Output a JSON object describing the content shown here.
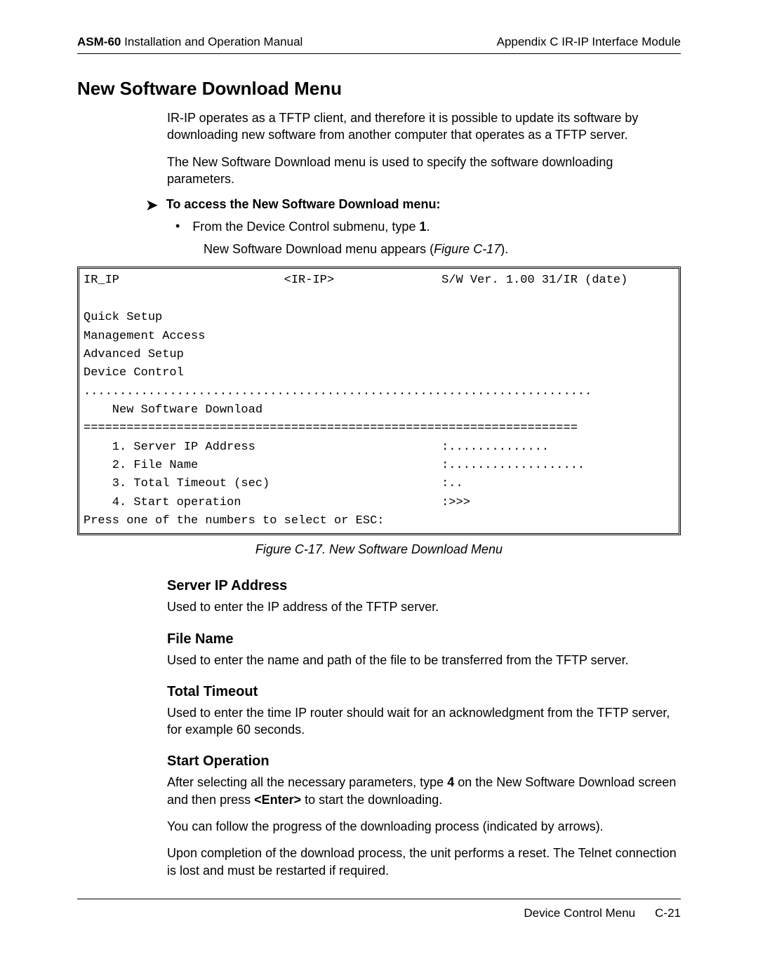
{
  "header": {
    "product": "ASM-60",
    "doc_title": "Installation and Operation Manual",
    "appendix": "Appendix C  IR-IP Interface Module"
  },
  "title": "New Software Download Menu",
  "intro_p1": "IR-IP operates as a TFTP client, and therefore it is possible to update its software by downloading new software from another computer that operates as a TFTP server.",
  "intro_p2": "The New Software Download menu is used to specify the software downloading parameters.",
  "procedure": {
    "lead": "To access the New Software Download menu:",
    "bullet_pre": "From the Device Control submenu, type ",
    "bullet_num": "1",
    "bullet_post": ".",
    "result_pre": "New Software Download menu appears (",
    "result_ref": "Figure C-17",
    "result_post": ")."
  },
  "terminal": "IR_IP                       <IR-IP>               S/W Ver. 1.00 31/IR (date)\n\nQuick Setup\nManagement Access\nAdvanced Setup\nDevice Control\n.......................................................................\n    New Software Download\n=====================================================================\n    1. Server IP Address                          :..............\n    2. File Name                                  :...................\n    3. Total Timeout (sec)                        :..\n    4. Start operation                            :>>>\nPress one of the numbers to select or ESC:",
  "figure_caption": "Figure C-17.  New Software Download Menu",
  "sections": {
    "server_ip": {
      "heading": "Server IP Address",
      "body": "Used to enter the IP address of the TFTP server."
    },
    "file_name": {
      "heading": "File Name",
      "body": "Used to enter the name and path of the file to be transferred from the TFTP server."
    },
    "total_timeout": {
      "heading": "Total Timeout",
      "body": "Used to enter the time IP router should wait for an acknowledgment from the TFTP server, for example 60 seconds."
    },
    "start_op": {
      "heading": "Start Operation",
      "p1_pre": "After selecting all the necessary parameters, type ",
      "p1_num": "4",
      "p1_mid": " on the New Software Download screen and then press ",
      "p1_key": "<Enter>",
      "p1_post": " to start the downloading.",
      "p2": "You can follow the progress of the downloading process (indicated by arrows).",
      "p3": "Upon completion of the download process, the unit performs a reset. The Telnet connection is lost and must be restarted if required."
    }
  },
  "footer": {
    "section": "Device Control Menu",
    "page": "C-21"
  }
}
